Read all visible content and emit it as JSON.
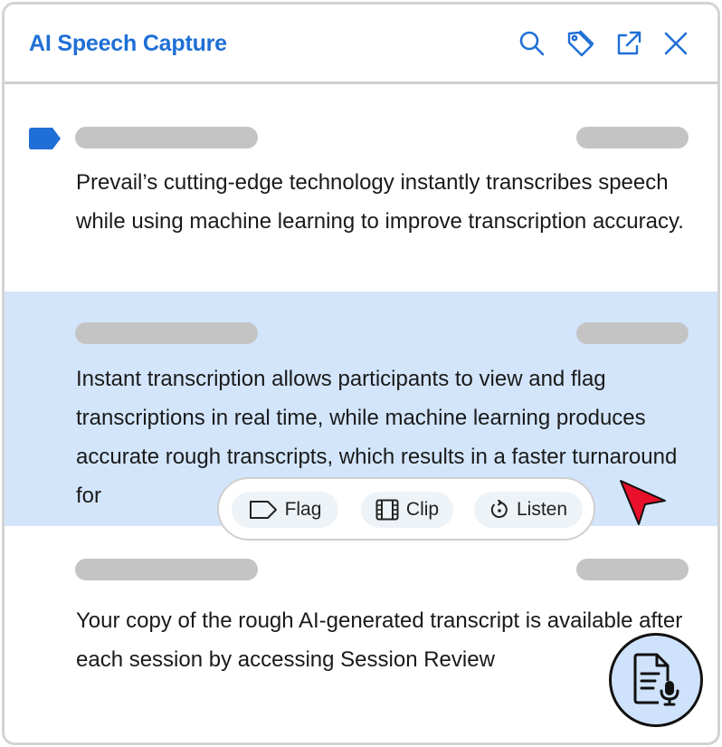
{
  "app": {
    "title": "AI Speech Capture"
  },
  "header_icons": [
    "search-icon",
    "tag-icon",
    "external-link-icon",
    "close-icon"
  ],
  "transcript": [
    {
      "text": "Prevail’s cutting-edge technology instantly transcribes speech while using machine learning to improve transcription accuracy.",
      "selected": false,
      "speaker_tag": true
    },
    {
      "text": "Instant transcription allows participants to view and flag transcriptions in real time, while machine learning produces accurate rough transcripts, which results in a faster turnaround for",
      "selected": true,
      "speaker_tag": false
    },
    {
      "text": "Your copy of the rough AI-generated transcript is available after each session by accessing Session Review",
      "selected": false,
      "speaker_tag": false
    }
  ],
  "toolbar": {
    "flag_label": "Flag",
    "clip_label": "Clip",
    "listen_label": "Listen"
  },
  "colors": {
    "accent": "#1f6fd6",
    "selection": "#d3e5fb",
    "cursor": "#e8102a",
    "skeleton": "#c4c4c4"
  }
}
